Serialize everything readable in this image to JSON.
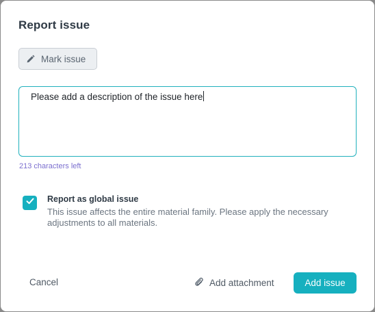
{
  "dialog": {
    "title": "Report issue",
    "mark_button": {
      "label": "Mark issue",
      "icon": "pencil-icon"
    },
    "description": {
      "value": "Please add a description of the issue here"
    },
    "char_counter": "213 characters left",
    "global_issue": {
      "checked": true,
      "title": "Report as global issue",
      "description": "This issue affects the entire material family. Please apply the necessary adjustments to all materials."
    },
    "footer": {
      "cancel_label": "Cancel",
      "attach_label": "Add attachment",
      "attach_icon": "paperclip-icon",
      "submit_label": "Add issue"
    }
  },
  "colors": {
    "accent": "#16b0bf",
    "counter": "#7b6fcf"
  }
}
